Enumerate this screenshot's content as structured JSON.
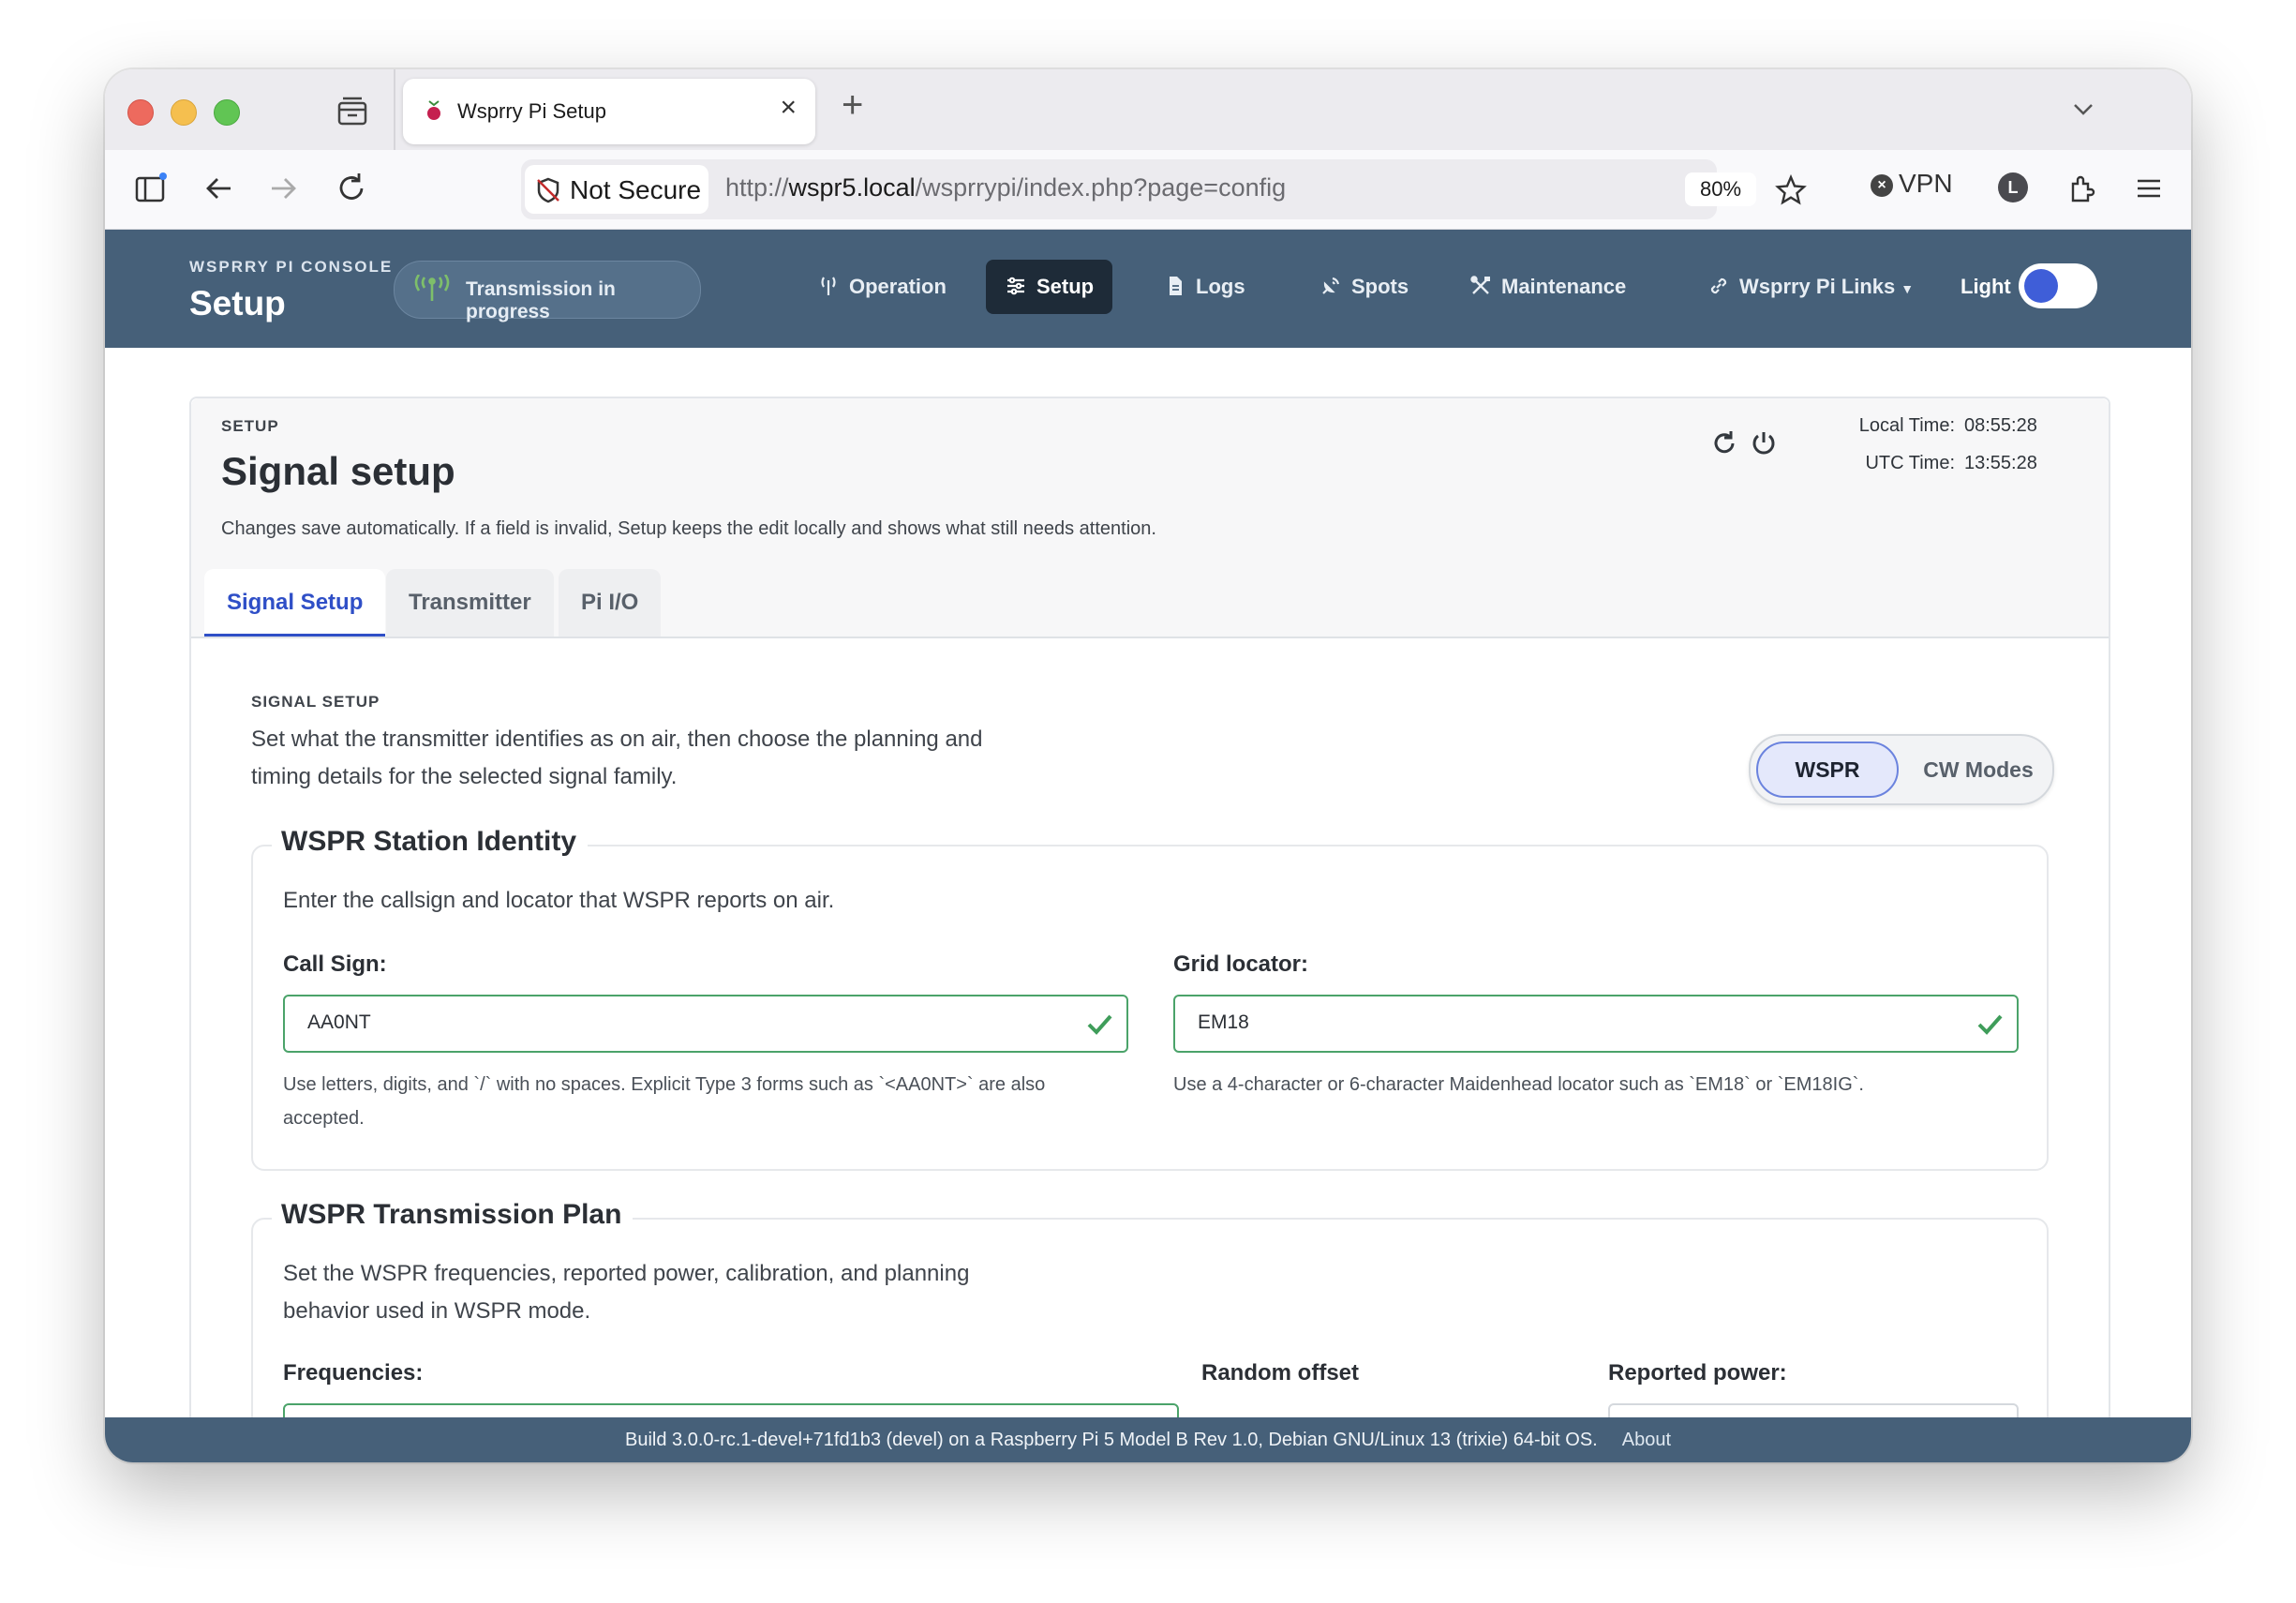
{
  "browser": {
    "tab_title": "Wsprry Pi Setup",
    "security_label": "Not Secure",
    "url_scheme": "http://",
    "url_host": "wspr5.local",
    "url_path": "/wsprrypi/index.php?page=config",
    "zoom": "80%",
    "vpn_label": "VPN",
    "profile_initial": "L"
  },
  "navbar": {
    "brand_small": "WSPRRY PI CONSOLE",
    "brand_title": "Setup",
    "status_pill": "Transmission in progress",
    "items": [
      {
        "label": "Operation",
        "icon": "antenna-icon"
      },
      {
        "label": "Setup",
        "icon": "sliders-icon"
      },
      {
        "label": "Logs",
        "icon": "document-icon"
      },
      {
        "label": "Spots",
        "icon": "satellite-icon"
      },
      {
        "label": "Maintenance",
        "icon": "tools-icon"
      },
      {
        "label": "Wsprry Pi Links",
        "icon": "link-icon"
      }
    ],
    "theme_label": "Light"
  },
  "card": {
    "eyebrow": "SETUP",
    "title": "Signal setup",
    "description": "Changes save automatically. If a field is invalid, Setup keeps the edit locally and shows what still needs attention.",
    "local_time_label": "Local Time:",
    "local_time": "08:55:28",
    "utc_time_label": "UTC Time:",
    "utc_time": "13:55:28",
    "tabs": [
      "Signal Setup",
      "Transmitter",
      "Pi I/O"
    ]
  },
  "signal_setup": {
    "eyebrow": "SIGNAL SETUP",
    "description": "Set what the transmitter identifies as on air, then choose the planning and timing details for the selected signal family.",
    "modes": [
      "WSPR",
      "CW Modes"
    ],
    "identity": {
      "legend": "WSPR Station Identity",
      "description": "Enter the callsign and locator that WSPR reports on air.",
      "callsign_label": "Call Sign:",
      "callsign_value": "AA0NT",
      "callsign_help": "Use letters, digits, and `/` with no spaces. Explicit Type 3 forms such as `<AA0NT>` are also accepted.",
      "grid_label": "Grid locator:",
      "grid_value": "EM18",
      "grid_help": "Use a 4-character or 6-character Maidenhead locator such as `EM18` or `EM18IG`."
    },
    "plan": {
      "legend": "WSPR Transmission Plan",
      "description": "Set the WSPR frequencies, reported power, calibration, and planning behavior used in WSPR mode.",
      "frequencies_label": "Frequencies:",
      "random_offset_label": "Random offset",
      "reported_power_label": "Reported power:"
    }
  },
  "footer": {
    "build": "Build  3.0.0-rc.1-devel+71fd1b3 (devel) on a Raspberry Pi 5 Model B Rev 1.0, Debian GNU/Linux 13 (trixie) 64-bit OS.",
    "about": "About"
  },
  "colors": {
    "navbar": "#466079",
    "accent": "#2f4fc7",
    "valid": "#4ba36a"
  }
}
